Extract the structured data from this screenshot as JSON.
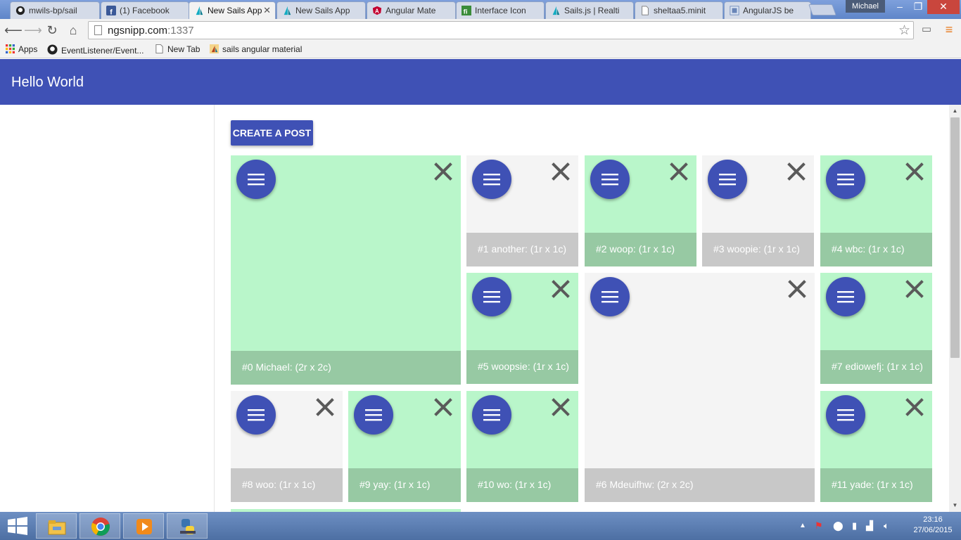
{
  "browser": {
    "tabs": [
      {
        "title": "mwils-bp/sail",
        "icon": "github-icon"
      },
      {
        "title": "(1) Facebook",
        "icon": "facebook-icon"
      },
      {
        "title": "New Sails App",
        "icon": "sails-icon",
        "active": true
      },
      {
        "title": "New Sails App",
        "icon": "sails-icon"
      },
      {
        "title": "Angular Mate",
        "icon": "angular-icon"
      },
      {
        "title": "Interface Icon",
        "icon": "fi-icon"
      },
      {
        "title": "Sails.js | Realti",
        "icon": "sails-icon"
      },
      {
        "title": "sheltaa5.minit",
        "icon": "page-icon"
      },
      {
        "title": "AngularJS be",
        "icon": "angularjs-icon"
      }
    ],
    "user": "Michael",
    "url_host": "ngsnipp.com",
    "url_port": ":1337",
    "bookmarks": [
      {
        "label": "Apps",
        "icon": "apps-grid-icon"
      },
      {
        "label": "EventListener/Event...",
        "icon": "github-icon"
      },
      {
        "label": "New Tab",
        "icon": "page-icon"
      },
      {
        "label": "sails angular material",
        "icon": "sails-icon"
      }
    ]
  },
  "app": {
    "title": "Hello World",
    "create_button": "CREATE A POST",
    "colors": {
      "primary": "#3f51b5",
      "tile_green": "#b9f6ca",
      "tile_grey": "#f4f4f4",
      "footer_green": "#97c9a3",
      "footer_grey": "#c8c8c8"
    },
    "tiles": [
      {
        "label": "#0 Michael: (2r x 2c)",
        "color": "green"
      },
      {
        "label": "#1 another: (1r x 1c)",
        "color": "grey"
      },
      {
        "label": "#2 woop: (1r x 1c)",
        "color": "green"
      },
      {
        "label": "#3 woopie: (1r x 1c)",
        "color": "grey"
      },
      {
        "label": "#4 wbc: (1r x 1c)",
        "color": "green"
      },
      {
        "label": "#5 woopsie: (1r x 1c)",
        "color": "green"
      },
      {
        "label": "#6 Mdeuifhw: (2r x 2c)",
        "color": "grey"
      },
      {
        "label": "#7 ediowefj: (1r x 1c)",
        "color": "green"
      },
      {
        "label": "#8 woo: (1r x 1c)",
        "color": "grey"
      },
      {
        "label": "#9 yay: (1r x 1c)",
        "color": "green"
      },
      {
        "label": "#10 wo: (1r x 1c)",
        "color": "green"
      },
      {
        "label": "#11 yade: (1r x 1c)",
        "color": "green"
      }
    ]
  },
  "taskbar": {
    "time": "23:16",
    "date": "27/06/2015",
    "items": [
      "file-explorer-icon",
      "chrome-icon",
      "media-player-icon",
      "python-icon"
    ]
  }
}
